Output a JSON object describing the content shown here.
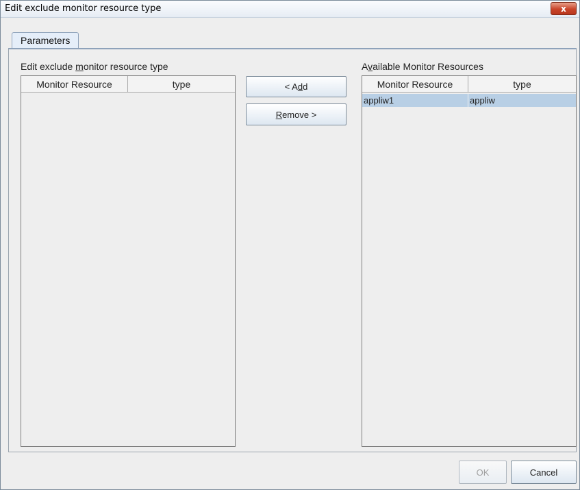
{
  "window": {
    "title": "Edit exclude monitor resource type",
    "close_glyph": "x"
  },
  "tabs": [
    {
      "label": "Parameters"
    }
  ],
  "left_panel": {
    "label_pre": "Edit exclude ",
    "label_mnemonic": "m",
    "label_post": "onitor resource type",
    "columns": [
      "Monitor Resource",
      "type"
    ],
    "rows": []
  },
  "buttons": {
    "add_pre": "< A",
    "add_mnemonic": "d",
    "add_post": "d",
    "remove_mnemonic": "R",
    "remove_post": "emove >",
    "ok": "OK",
    "cancel": "Cancel"
  },
  "right_panel": {
    "label_pre": "A",
    "label_mnemonic": "v",
    "label_post": "ailable Monitor Resources",
    "columns": [
      "Monitor Resource",
      "type"
    ],
    "rows": [
      {
        "monitor_resource": "appliw1",
        "type": "appliw",
        "selected": true
      }
    ]
  },
  "colors": {
    "selected_row": "#b8cfe5",
    "close_button": "#c9452a"
  },
  "icons": {
    "close": "close-icon"
  }
}
